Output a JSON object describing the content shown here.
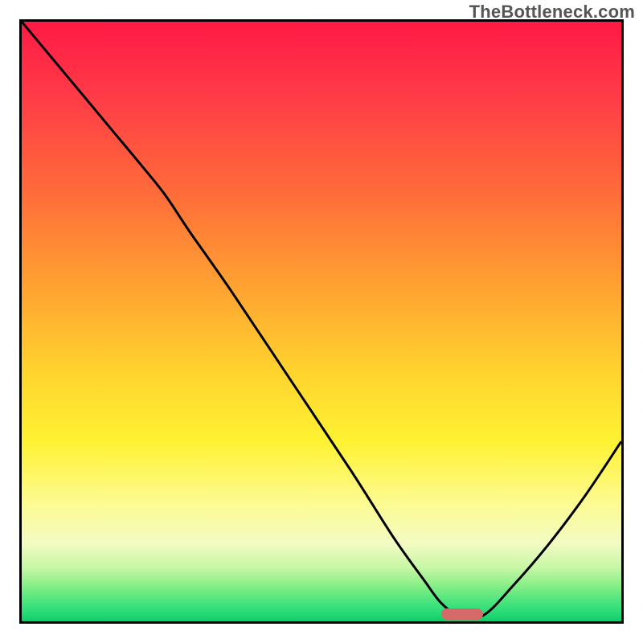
{
  "watermark": "TheBottleneck.com",
  "chart_data": {
    "type": "line",
    "title": "",
    "xlabel": "",
    "ylabel": "",
    "xlim": [
      0,
      100
    ],
    "ylim": [
      0,
      100
    ],
    "grid": false,
    "legend": false,
    "series": [
      {
        "name": "bottleneck-curve",
        "description": "Black curve starting at top-left, descending to a minimum near x≈73 (touching the green band at y≈0), then rising toward the right edge.",
        "x": [
          0,
          5,
          10,
          15,
          20,
          24,
          28,
          35,
          45,
          55,
          62,
          67,
          70,
          73,
          77,
          82,
          88,
          94,
          100
        ],
        "values": [
          100,
          94,
          88,
          82,
          76,
          71,
          65,
          55,
          40,
          25,
          14,
          7,
          3,
          1,
          1,
          6,
          13,
          21,
          30
        ]
      }
    ],
    "annotations": [
      {
        "name": "highlight-marker",
        "shape": "rounded-bar",
        "color": "#d66a6a",
        "x_range": [
          70,
          77
        ],
        "y": 1.2,
        "height": 2.0
      }
    ],
    "background_gradient": {
      "direction": "vertical",
      "stops": [
        {
          "pos": 0.0,
          "color": "#ff1a45"
        },
        {
          "pos": 0.28,
          "color": "#ff6a3a"
        },
        {
          "pos": 0.58,
          "color": "#ffd22e"
        },
        {
          "pos": 0.8,
          "color": "#fdfb8f"
        },
        {
          "pos": 0.94,
          "color": "#88ef87"
        },
        {
          "pos": 1.0,
          "color": "#15c76a"
        }
      ]
    }
  }
}
